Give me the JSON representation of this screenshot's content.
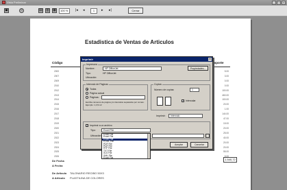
{
  "window": {
    "title": "Vista Preliminar"
  },
  "toolbar": {
    "zoom": "100 %",
    "page": "1",
    "close_label": "Cerrar"
  },
  "report": {
    "title": "Estadistica de Ventas de Articulos",
    "col_codigo": "Código",
    "col_importe": "Importe",
    "codes": [
      "2000",
      "2007",
      "2009",
      "2010",
      "2012",
      "2013",
      "2014",
      "2015",
      "2016",
      "2017",
      "2018",
      "2019",
      "2020",
      "2021",
      "2022",
      "2023",
      "2024",
      "2025",
      "2026"
    ],
    "amounts": [
      "5.00",
      "3.00",
      "0.00",
      "0.00",
      "100.00",
      "460.00",
      "100.00",
      "20.00",
      "1.00",
      "144.00",
      "47.00",
      "15.00",
      "20.00",
      "25.00",
      "40.00",
      "20.00",
      "20.00",
      "55.00",
      "5.00"
    ],
    "total": "1.540,72",
    "footer": [
      {
        "label": "De Fecha",
        "value": ""
      },
      {
        "label": "A Fecha",
        "value": ""
      },
      {
        "label": "De Articulo",
        "value": "TALONARIO RECIBO 50X3"
      },
      {
        "label": "A Articulo",
        "value": "PLASTILINA DE COLORES"
      }
    ]
  },
  "dialog": {
    "title": "Imprimir",
    "printer_group": "Impresora",
    "name_label": "Nombre:",
    "printer_name": "HP OfficeJet",
    "properties_button": "Propiedades...",
    "type_label": "Tipo:",
    "type_value": "HP OfficeJet",
    "location_label": "Ubicación:",
    "range_group": "Intervalo de Páginas",
    "range_all": "Todas",
    "range_current": "Página actual",
    "range_pages": "Páginas:",
    "range_hint": "Escriba números de página y/o intervalos separados por comas. Ejemplo: 1,3,5-12",
    "copies_group": "Copias",
    "copies_label": "Número de copias:",
    "copies_value": "1",
    "collate_label": "Intercalar",
    "print_label": "Imprimir:",
    "print_value": "Intervalo",
    "to_file_label": "Imprimir a un archivo",
    "file_type_label": "Tipo:",
    "file_type_value": "Excel File",
    "file_location_label": "Ubicación:",
    "file_types": [
      "Excel File",
      "Excel File",
      "Excel File",
      "HTML File",
      "PDF File",
      "PDF File",
      "RTF File",
      "TXT File",
      "XLS File",
      "XML File",
      "Excel File"
    ],
    "selected_index": 2,
    "accept_button": "Aceptar",
    "cancel_button": "Cancelar"
  }
}
